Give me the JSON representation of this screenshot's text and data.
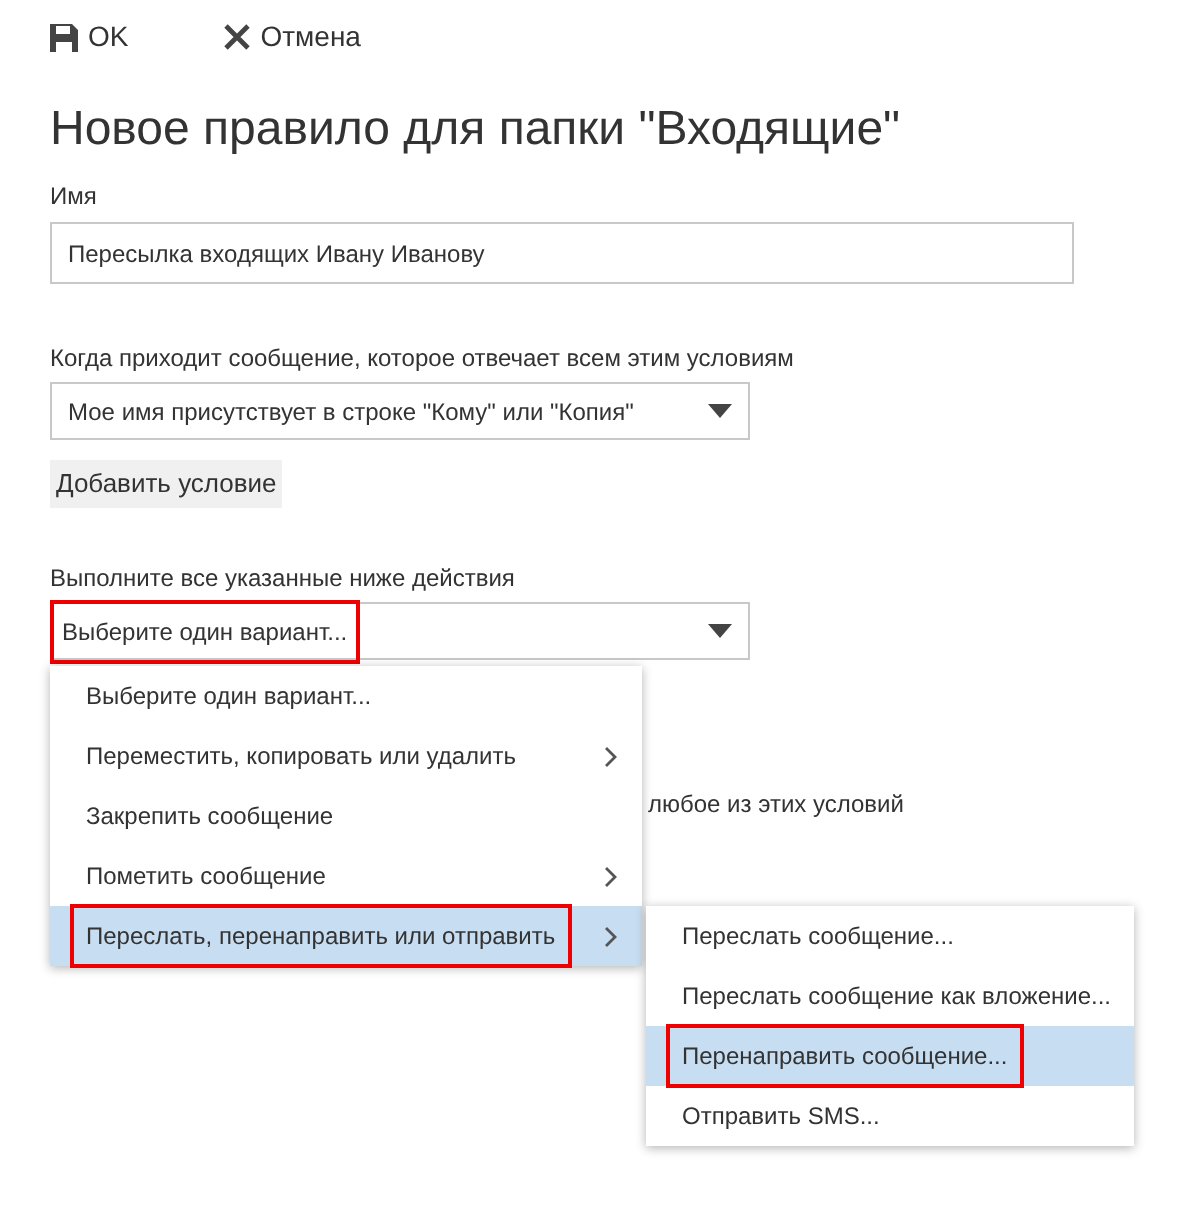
{
  "toolbar": [
    {
      "kind": "save",
      "label": "OK"
    },
    {
      "kind": "cancel",
      "label": "Отмена"
    }
  ],
  "title": "Новое правило для папки \"Входящие\"",
  "name_field": {
    "label": "Имя",
    "value": "Пересылка входящих Ивану Иванову"
  },
  "condition": {
    "label": "Когда приходит сообщение, которое отвечает всем этим условиям",
    "value": "Мое имя присутствует в строке \"Кому\" или \"Копия\"",
    "add_button": "Добавить условие"
  },
  "action": {
    "label": "Выполните все указанные ниже действия",
    "value": "Выберите один вариант...",
    "highlighted": true
  },
  "partly_hidden_text": "любое из этих условий",
  "action_menu": [
    {
      "label": "Выберите один вариант...",
      "has_submenu": false,
      "selected": false,
      "highlighted": false
    },
    {
      "label": "Переместить, копировать или удалить",
      "has_submenu": true,
      "selected": false,
      "highlighted": false
    },
    {
      "label": "Закрепить сообщение",
      "has_submenu": false,
      "selected": false,
      "highlighted": false
    },
    {
      "label": "Пометить сообщение",
      "has_submenu": true,
      "selected": false,
      "highlighted": false
    },
    {
      "label": "Переслать, перенаправить или отправить",
      "has_submenu": true,
      "selected": true,
      "highlighted": true
    }
  ],
  "submenu": [
    {
      "label": "Переслать сообщение...",
      "selected": false,
      "highlighted": false
    },
    {
      "label": "Переслать сообщение как вложение...",
      "selected": false,
      "highlighted": false
    },
    {
      "label": "Перенаправить сообщение...",
      "selected": true,
      "highlighted": true
    },
    {
      "label": "Отправить SMS...",
      "selected": false,
      "highlighted": false
    }
  ]
}
